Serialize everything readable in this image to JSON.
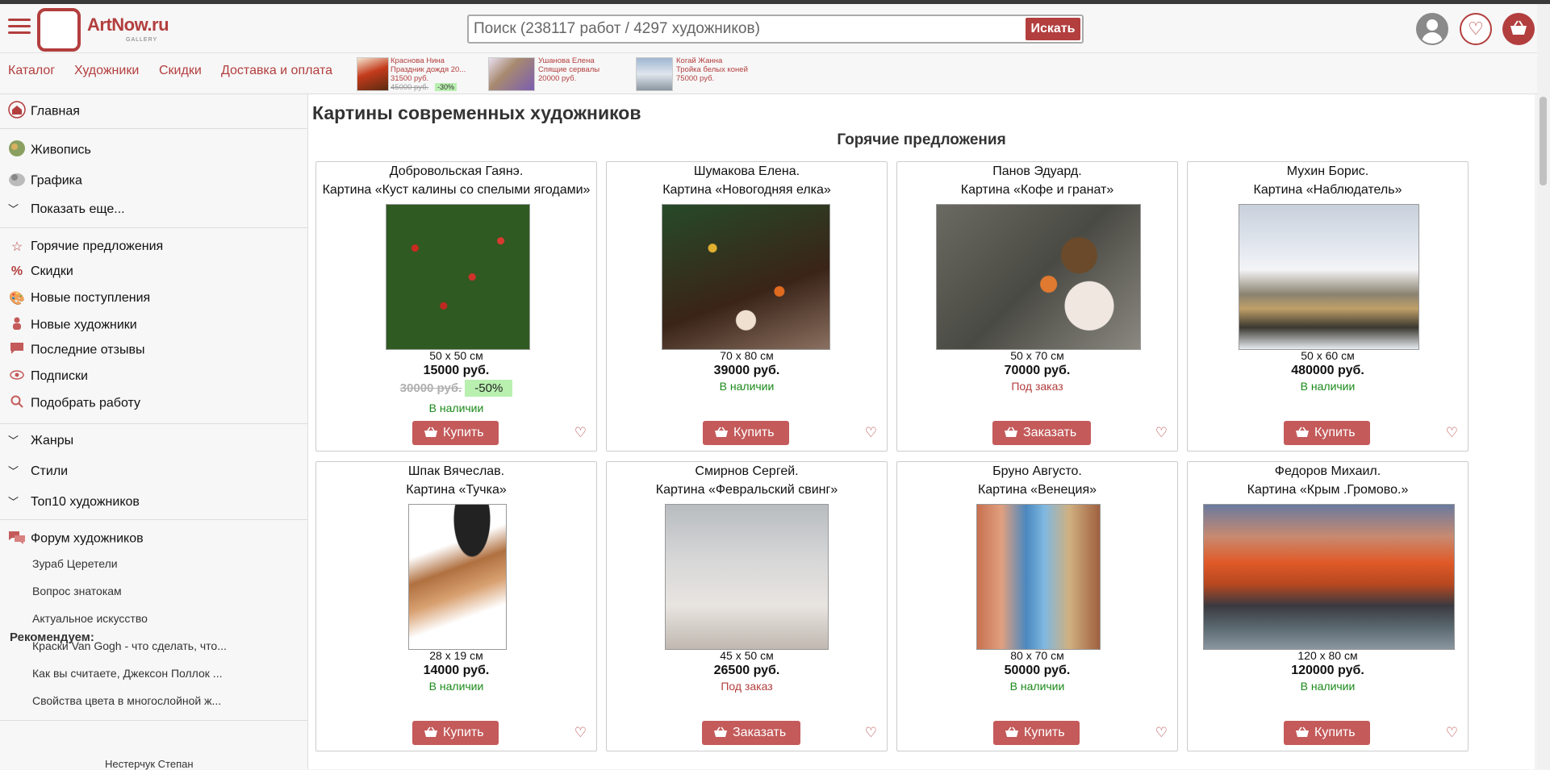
{
  "header": {
    "logo_text": "ArtNow.ru",
    "logo_sub": "GALLERY",
    "search_placeholder": "Поиск (238117 работ / 4297 художников)",
    "search_button": "Искать"
  },
  "nav": {
    "items": [
      "Каталог",
      "Художники",
      "Скидки",
      "Доставка и оплата"
    ]
  },
  "promos": [
    {
      "artist": "Краснова Нина",
      "title": "Праздник дождя 20...",
      "price": "31500 руб.",
      "old_price": "45000 руб.",
      "discount": "-30%"
    },
    {
      "artist": "Ушанова Елена",
      "title": "Спящие сервалы",
      "price": "20000 руб."
    },
    {
      "artist": "Когай Жанна",
      "title": "Тройка белых коней",
      "price": "75000 руб."
    }
  ],
  "sidebar": {
    "home": "Главная",
    "painting": "Живопись",
    "graphics": "Графика",
    "show_more": "Показать еще...",
    "links": [
      "Горячие предложения",
      "Скидки",
      "Новые поступления",
      "Новые художники",
      "Последние отзывы",
      "Подписки",
      "Подобрать работу"
    ],
    "genres": "Жанры",
    "styles": "Стили",
    "top10": "Топ10 художников",
    "forum": "Форум художников",
    "forum_topics": [
      "Зураб Церетели",
      "Вопрос знатокам",
      "Актуальное искусство",
      "Краски Van Gogh - что сделать, что...",
      "Как вы считаете, Джексон Поллок ...",
      "Свойства цвета в многослойной ж..."
    ],
    "recommend": "Рекомендуем:",
    "recommend_name": "Нестерчук Степан"
  },
  "main": {
    "page_title": "Картины современных художников",
    "section_title": "Горячие предложения"
  },
  "cards": [
    {
      "artist": "Добровольская Гаянэ.",
      "title": "Картина «Куст калины со спелыми ягодами»",
      "size": "50 x 50 см",
      "price": "15000 руб.",
      "old_price": "30000 руб.",
      "discount": "-50%",
      "availability": "В наличии",
      "button": "Купить"
    },
    {
      "artist": "Шумакова Елена.",
      "title": "Картина «Новогодняя елка»",
      "size": "70 x 80 см",
      "price": "39000 руб.",
      "availability": "В наличии",
      "button": "Купить"
    },
    {
      "artist": "Панов Эдуард.",
      "title": "Картина «Кофе и гранат»",
      "size": "50 x 70 см",
      "price": "70000 руб.",
      "availability": "Под заказ",
      "button": "Заказать"
    },
    {
      "artist": "Мухин Борис.",
      "title": "Картина «Наблюдатель»",
      "size": "50 x 60 см",
      "price": "480000 руб.",
      "availability": "В наличии",
      "button": "Купить"
    },
    {
      "artist": "Шпак Вячеслав.",
      "title": "Картина «Тучка»",
      "size": "28 x 19 см",
      "price": "14000 руб.",
      "availability": "В наличии",
      "button": "Купить"
    },
    {
      "artist": "Смирнов Сергей.",
      "title": "Картина «Февральский свинг»",
      "size": "45 x 50 см",
      "price": "26500 руб.",
      "availability": "Под заказ",
      "button": "Заказать"
    },
    {
      "artist": "Бруно Августо.",
      "title": "Картина «Венеция»",
      "size": "80 x 70 см",
      "price": "50000 руб.",
      "availability": "В наличии",
      "button": "Купить"
    },
    {
      "artist": "Федоров Михаил.",
      "title": "Картина «Крым .Громово.»",
      "size": "120 x 80 см",
      "price": "120000 руб.",
      "availability": "В наличии",
      "button": "Купить"
    }
  ],
  "colors": {
    "accent": "#b33e3e",
    "in_stock": "#1a8a1a",
    "on_order": "#b33e3e",
    "discount_badge": "#b9f0b0"
  }
}
